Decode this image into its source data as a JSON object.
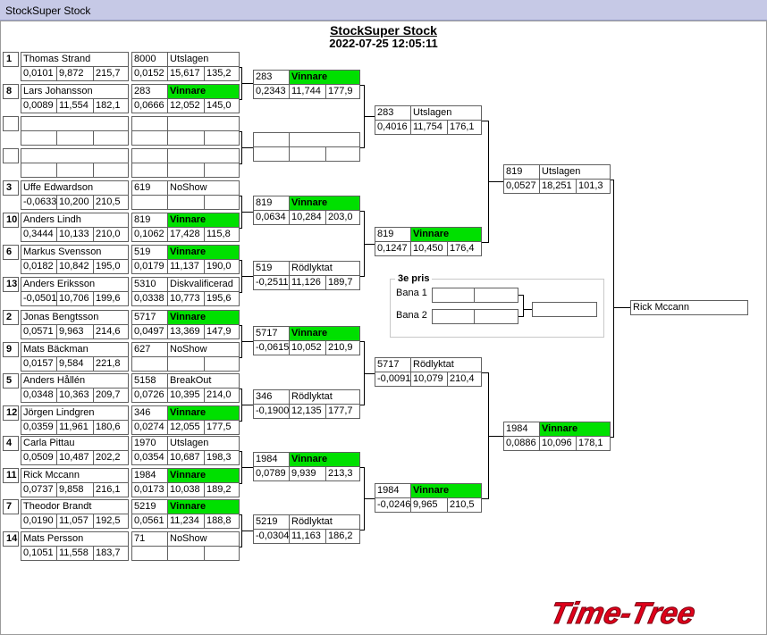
{
  "window": {
    "title": "StockSuper Stock"
  },
  "header": {
    "title": "StockSuper Stock",
    "datetime": "2022-07-25 12:05:11"
  },
  "round1": [
    {
      "seed": "1",
      "name": "Thomas Strand",
      "r": "0,0101",
      "et": "9,872",
      "speed": "215,7",
      "car": "8000",
      "status": "Utslagen",
      "r2": "0,0152",
      "et2": "15,617",
      "speed2": "135,2",
      "winner": false
    },
    {
      "seed": "8",
      "name": "Lars Johansson",
      "r": "0,0089",
      "et": "11,554",
      "speed": "182,1",
      "car": "283",
      "status": "Vinnare",
      "r2": "0,0666",
      "et2": "12,052",
      "speed2": "145,0",
      "winner": true
    },
    {
      "seed": "",
      "name": "",
      "r": "",
      "et": "",
      "speed": "",
      "car": "",
      "status": "",
      "r2": "",
      "et2": "",
      "speed2": "",
      "winner": false
    },
    {
      "seed": "",
      "name": "",
      "r": "",
      "et": "",
      "speed": "",
      "car": "",
      "status": "",
      "r2": "",
      "et2": "",
      "speed2": "",
      "winner": false
    },
    {
      "seed": "3",
      "name": "Uffe Edwardson",
      "r": "-0,0633",
      "et": "10,200",
      "speed": "210,5",
      "car": "619",
      "status": "NoShow",
      "r2": "",
      "et2": "",
      "speed2": "",
      "winner": false
    },
    {
      "seed": "10",
      "name": "Anders Lindh",
      "r": "0,3444",
      "et": "10,133",
      "speed": "210,0",
      "car": "819",
      "status": "Vinnare",
      "r2": "0,1062",
      "et2": "17,428",
      "speed2": "115,8",
      "winner": true
    },
    {
      "seed": "6",
      "name": "Markus Svensson",
      "r": "0,0182",
      "et": "10,842",
      "speed": "195,0",
      "car": "519",
      "status": "Vinnare",
      "r2": "0,0179",
      "et2": "11,137",
      "speed2": "190,0",
      "winner": true
    },
    {
      "seed": "13",
      "name": "Anders Eriksson",
      "r": "-0,0501",
      "et": "10,706",
      "speed": "199,6",
      "car": "5310",
      "status": "Diskvalificerad",
      "r2": "0,0338",
      "et2": "10,773",
      "speed2": "195,6",
      "winner": false
    },
    {
      "seed": "2",
      "name": "Jonas Bengtsson",
      "r": "0,0571",
      "et": "9,963",
      "speed": "214,6",
      "car": "5717",
      "status": "Vinnare",
      "r2": "0,0497",
      "et2": "13,369",
      "speed2": "147,9",
      "winner": true
    },
    {
      "seed": "9",
      "name": "Mats Bäckman",
      "r": "0,0157",
      "et": "9,584",
      "speed": "221,8",
      "car": "627",
      "status": "NoShow",
      "r2": "",
      "et2": "",
      "speed2": "",
      "winner": false
    },
    {
      "seed": "5",
      "name": "Anders Hållén",
      "r": "0,0348",
      "et": "10,363",
      "speed": "209,7",
      "car": "5158",
      "status": "BreakOut",
      "r2": "0,0726",
      "et2": "10,395",
      "speed2": "214,0",
      "winner": false
    },
    {
      "seed": "12",
      "name": "Jörgen Lindgren",
      "r": "0,0359",
      "et": "11,961",
      "speed": "180,6",
      "car": "346",
      "status": "Vinnare",
      "r2": "0,0274",
      "et2": "12,055",
      "speed2": "177,5",
      "winner": true
    },
    {
      "seed": "4",
      "name": "Carla Pittau",
      "r": "0,0509",
      "et": "10,487",
      "speed": "202,2",
      "car": "1970",
      "status": "Utslagen",
      "r2": "0,0354",
      "et2": "10,687",
      "speed2": "198,3",
      "winner": false
    },
    {
      "seed": "11",
      "name": "Rick Mccann",
      "r": "0,0737",
      "et": "9,858",
      "speed": "216,1",
      "car": "1984",
      "status": "Vinnare",
      "r2": "0,0173",
      "et2": "10,038",
      "speed2": "189,2",
      "winner": true
    },
    {
      "seed": "7",
      "name": "Theodor Brandt",
      "r": "0,0190",
      "et": "11,057",
      "speed": "192,5",
      "car": "5219",
      "status": "Vinnare",
      "r2": "0,0561",
      "et2": "11,234",
      "speed2": "188,8",
      "winner": true
    },
    {
      "seed": "14",
      "name": "Mats Persson",
      "r": "0,1051",
      "et": "11,558",
      "speed": "183,7",
      "car": "71",
      "status": "NoShow",
      "r2": "",
      "et2": "",
      "speed2": "",
      "winner": false
    }
  ],
  "round2": [
    {
      "car": "283",
      "status": "Vinnare",
      "r": "0,2343",
      "et": "11,744",
      "speed": "177,9",
      "winner": true
    },
    {
      "car": "",
      "status": "",
      "r": "",
      "et": "",
      "speed": "",
      "winner": false
    },
    {
      "car": "819",
      "status": "Vinnare",
      "r": "0,0634",
      "et": "10,284",
      "speed": "203,0",
      "winner": true
    },
    {
      "car": "519",
      "status": "Rödlyktat",
      "r": "-0,2511",
      "et": "11,126",
      "speed": "189,7",
      "winner": false
    },
    {
      "car": "5717",
      "status": "Vinnare",
      "r": "-0,0615",
      "et": "10,052",
      "speed": "210,9",
      "winner": true
    },
    {
      "car": "346",
      "status": "Rödlyktat",
      "r": "-0,1900",
      "et": "12,135",
      "speed": "177,7",
      "winner": false
    },
    {
      "car": "1984",
      "status": "Vinnare",
      "r": "0,0789",
      "et": "9,939",
      "speed": "213,3",
      "winner": true
    },
    {
      "car": "5219",
      "status": "Rödlyktat",
      "r": "-0,0304",
      "et": "11,163",
      "speed": "186,2",
      "winner": false
    }
  ],
  "round3": [
    {
      "car": "283",
      "status": "Utslagen",
      "r": "0,4016",
      "et": "11,754",
      "speed": "176,1",
      "winner": false
    },
    {
      "car": "819",
      "status": "Vinnare",
      "r": "0,1247",
      "et": "10,450",
      "speed": "176,4",
      "winner": true
    },
    {
      "car": "5717",
      "status": "Rödlyktat",
      "r": "-0,0091",
      "et": "10,079",
      "speed": "210,4",
      "winner": false
    },
    {
      "car": "1984",
      "status": "Vinnare",
      "r": "-0,0246",
      "et": "9,965",
      "speed": "210,5",
      "winner": true
    }
  ],
  "round4": [
    {
      "car": "819",
      "status": "Utslagen",
      "r": "0,0527",
      "et": "18,251",
      "speed": "101,3",
      "winner": false
    },
    {
      "car": "1984",
      "status": "Vinnare",
      "r": "0,0886",
      "et": "10,096",
      "speed": "178,1",
      "winner": true
    }
  ],
  "final": {
    "champion": "Rick Mccann"
  },
  "third_prize": {
    "title": "3e pris",
    "lane1_label": "Bana 1",
    "lane2_label": "Bana 2",
    "lane1_value": "",
    "lane2_value": "",
    "result": ""
  },
  "logo": {
    "text": "Time-Tree",
    "color": "#e0001a"
  },
  "colors": {
    "winner": "#00e000",
    "titlebar": "#c6c9e6"
  }
}
